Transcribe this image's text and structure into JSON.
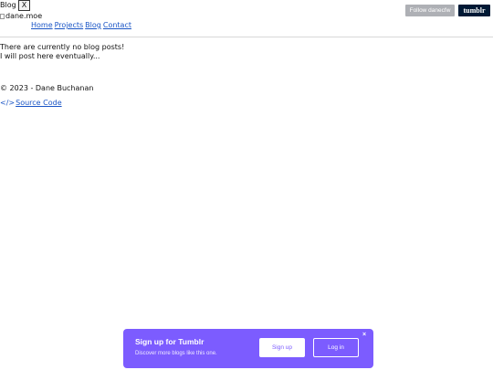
{
  "header": {
    "title": "Blog",
    "close_label": "X",
    "logo_alt": "dane.moe"
  },
  "nav": {
    "items": [
      {
        "label": "Home"
      },
      {
        "label": "Projects"
      },
      {
        "label": "Blog"
      },
      {
        "label": "Contact"
      }
    ]
  },
  "main": {
    "empty_line_1": "There are currently no blog posts!",
    "empty_line_2": "I will post here eventually..."
  },
  "footer": {
    "copyright": "© 2023 - Dane Buchanan",
    "source_icon": "</>",
    "source_label": " Source Code"
  },
  "tumblr_bar": {
    "follow_label": "Follow danecfw",
    "brand_label": "tumblr"
  },
  "signup_banner": {
    "title": "Sign up for Tumblr",
    "subtitle": "Discover more blogs like this one.",
    "signup_label": "Sign up",
    "login_label": "Log in",
    "dismiss_label": "×"
  },
  "colors": {
    "link": "#1a55c6",
    "banner": "#7c5cff",
    "tumblr_navy": "#001935",
    "follow_gray": "#aeb0b5"
  }
}
